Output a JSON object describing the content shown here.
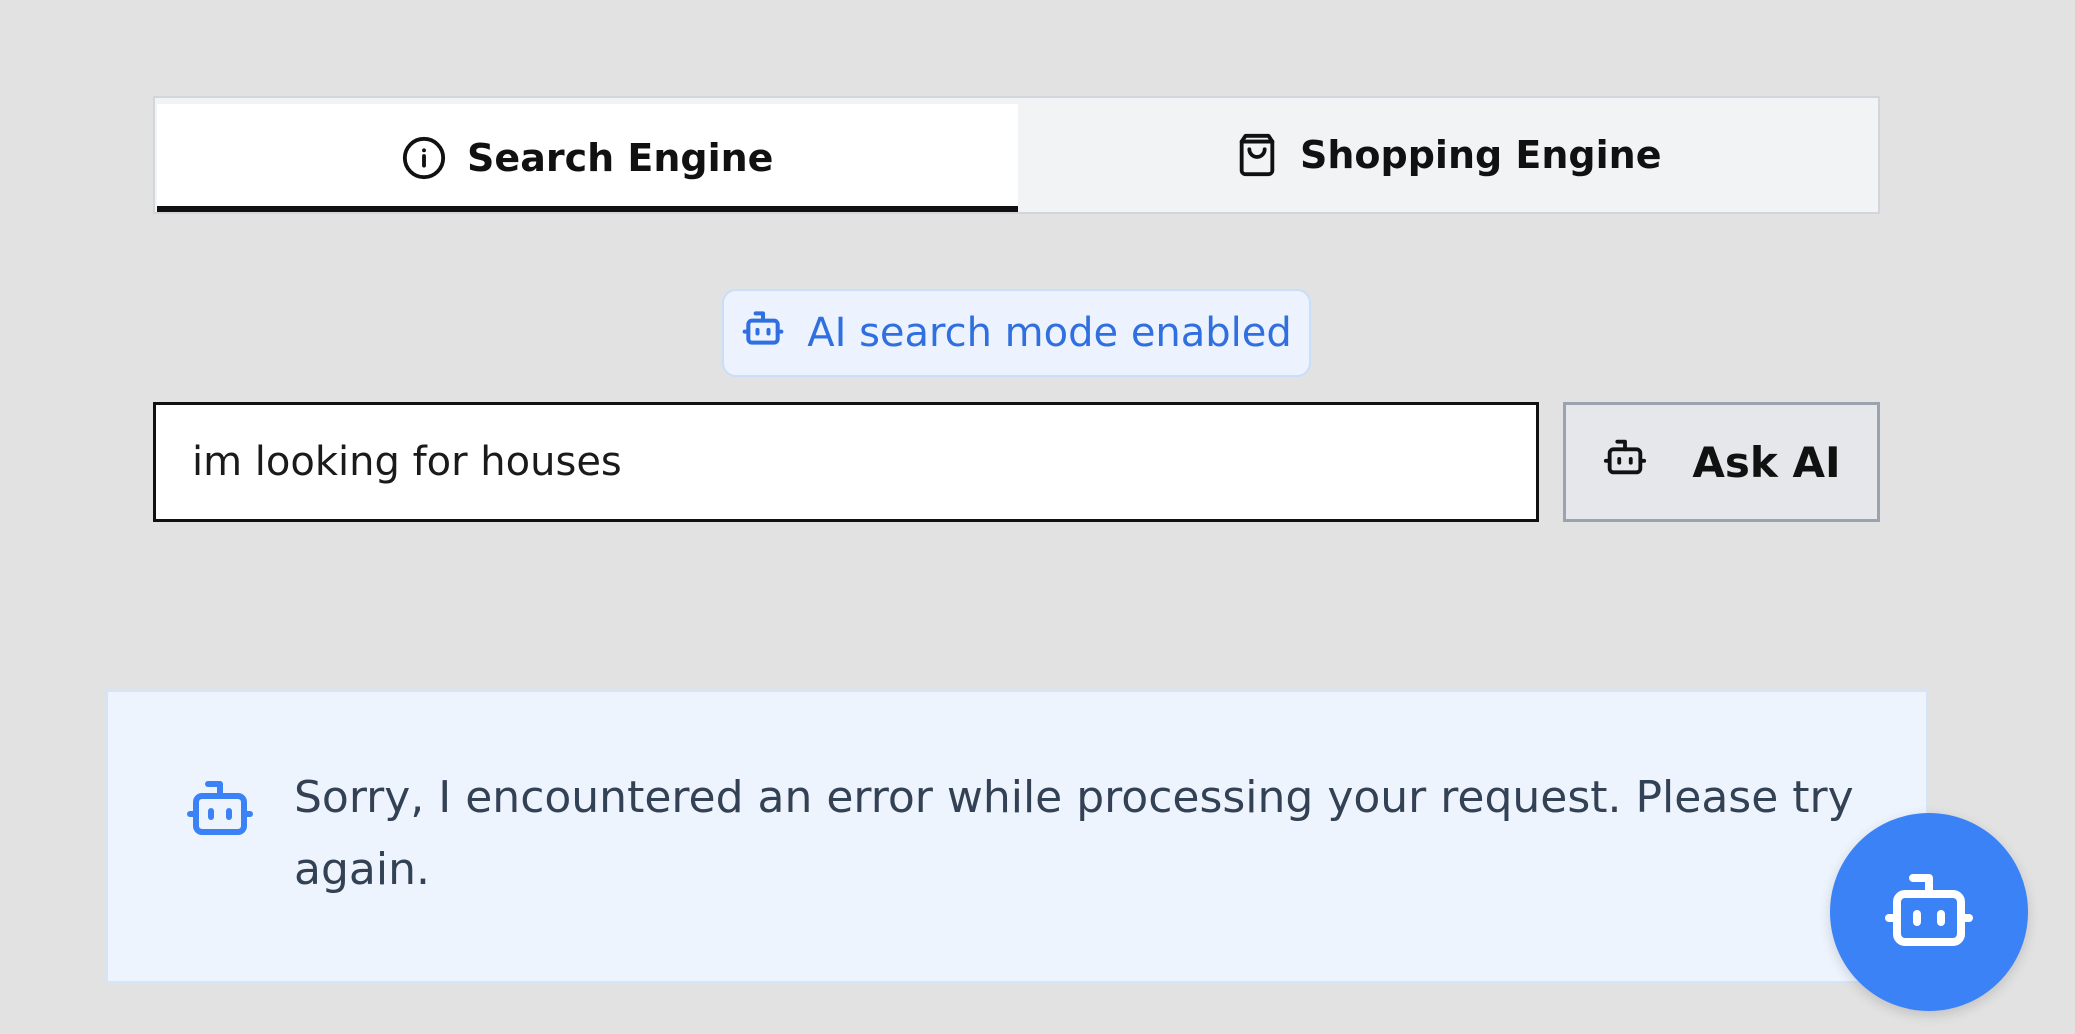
{
  "tabs": [
    {
      "label": "Search Engine",
      "icon": "info-icon",
      "active": true
    },
    {
      "label": "Shopping Engine",
      "icon": "shopping-bag-icon",
      "active": false
    }
  ],
  "ai_badge": {
    "label": "AI search mode enabled",
    "icon": "robot-icon",
    "color": "#2f6fe0"
  },
  "search": {
    "value": "im looking for houses"
  },
  "ask_button": {
    "label": "Ask AI",
    "icon": "robot-icon"
  },
  "error": {
    "message": "Sorry, I encountered an error while processing your request. Please try again.",
    "icon": "robot-icon"
  },
  "fab": {
    "icon": "robot-icon",
    "color": "#3b82f6"
  }
}
